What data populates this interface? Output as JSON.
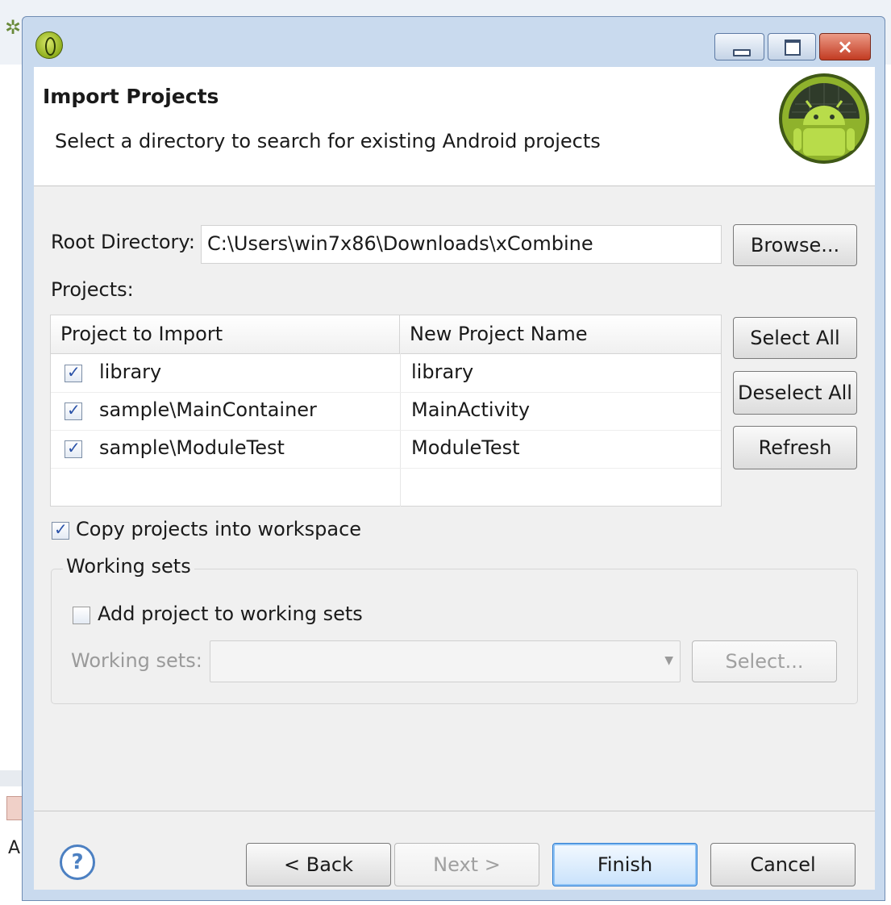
{
  "window": {
    "app_icon": "eclipse-icon",
    "controls": {
      "minimize": "minimize-icon",
      "maximize": "maximize-icon",
      "close": "close-icon",
      "close_glyph": "×"
    }
  },
  "background": {
    "left_strip_letter": "A"
  },
  "header": {
    "title": "Import Projects",
    "description": "Select a directory to search for existing Android projects",
    "logo": "android-logo"
  },
  "root_directory": {
    "label": "Root Directory:",
    "value": "C:\\Users\\win7x86\\Downloads\\xCombine",
    "browse_label": "Browse..."
  },
  "projects": {
    "label": "Projects:",
    "columns": [
      "Project to Import",
      "New Project Name"
    ],
    "rows": [
      {
        "checked": true,
        "project": "library",
        "new_name": "library"
      },
      {
        "checked": true,
        "project": "sample\\MainContainer",
        "new_name": "MainActivity"
      },
      {
        "checked": true,
        "project": "sample\\ModuleTest",
        "new_name": "ModuleTest"
      }
    ],
    "select_all_label": "Select All",
    "deselect_all_label": "Deselect All",
    "refresh_label": "Refresh"
  },
  "copy_projects": {
    "checked": true,
    "label": "Copy projects into workspace"
  },
  "working_sets": {
    "legend": "Working sets",
    "add_checked": false,
    "add_label": "Add project to working sets",
    "sets_label": "Working sets:",
    "sets_value": "",
    "select_label": "Select..."
  },
  "footer": {
    "help_glyph": "?",
    "back_label": "< Back",
    "next_label": "Next >",
    "finish_label": "Finish",
    "cancel_label": "Cancel"
  },
  "colors": {
    "accent": "#2b7bd1",
    "title_bar": "#c9daee",
    "android_green": "#9bc43a"
  }
}
